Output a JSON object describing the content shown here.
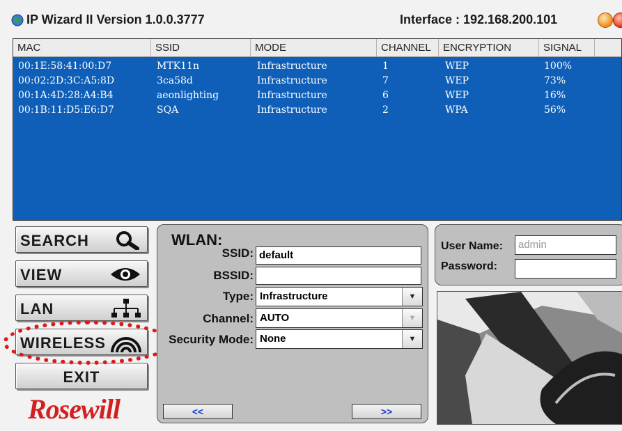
{
  "window": {
    "title": "IP Wizard II  Version 1.0.0.3777",
    "interface_label": "Interface : 192.168.200.101"
  },
  "device_list": {
    "columns": [
      "MAC",
      "SSID",
      "MODE",
      "CHANNEL",
      "ENCRYPTION",
      "SIGNAL"
    ],
    "rows": [
      [
        "00:1E:58:41:00:D7",
        "MTK11n",
        "Infrastructure",
        "1",
        "WEP",
        "100%"
      ],
      [
        "00:02:2D:3C:A5:8D",
        "3ca58d",
        "Infrastructure",
        "7",
        "WEP",
        "73%"
      ],
      [
        "00:1A:4D:28:A4:B4",
        "aeonlighting",
        "Infrastructure",
        "6",
        "WEP",
        "16%"
      ],
      [
        "00:1B:11:D5:E6:D7",
        "SQA",
        "Infrastructure",
        "2",
        "WPA",
        "56%"
      ]
    ]
  },
  "nav": {
    "search": "SEARCH",
    "view": "VIEW",
    "lan": "LAN",
    "wireless": "WIRELESS",
    "exit": "EXIT"
  },
  "wlan": {
    "title": "WLAN:",
    "ssid_label": "SSID:",
    "ssid_value": "default",
    "bssid_label": "BSSID:",
    "bssid_value": "",
    "type_label": "Type:",
    "type_value": "Infrastructure",
    "channel_label": "Channel:",
    "channel_value": "AUTO",
    "security_label": "Security Mode:",
    "security_value": "None",
    "prev": "<<",
    "next": ">>"
  },
  "login": {
    "user_label": "User Name:",
    "user_placeholder": "admin",
    "password_label": "Password:"
  },
  "brand": {
    "logo_text": "Rosewill"
  },
  "colors": {
    "list_bg": "#0f5fb8",
    "highlight": "#e01818",
    "logo": "#d22020",
    "nav_text": "#1a3fd0"
  }
}
